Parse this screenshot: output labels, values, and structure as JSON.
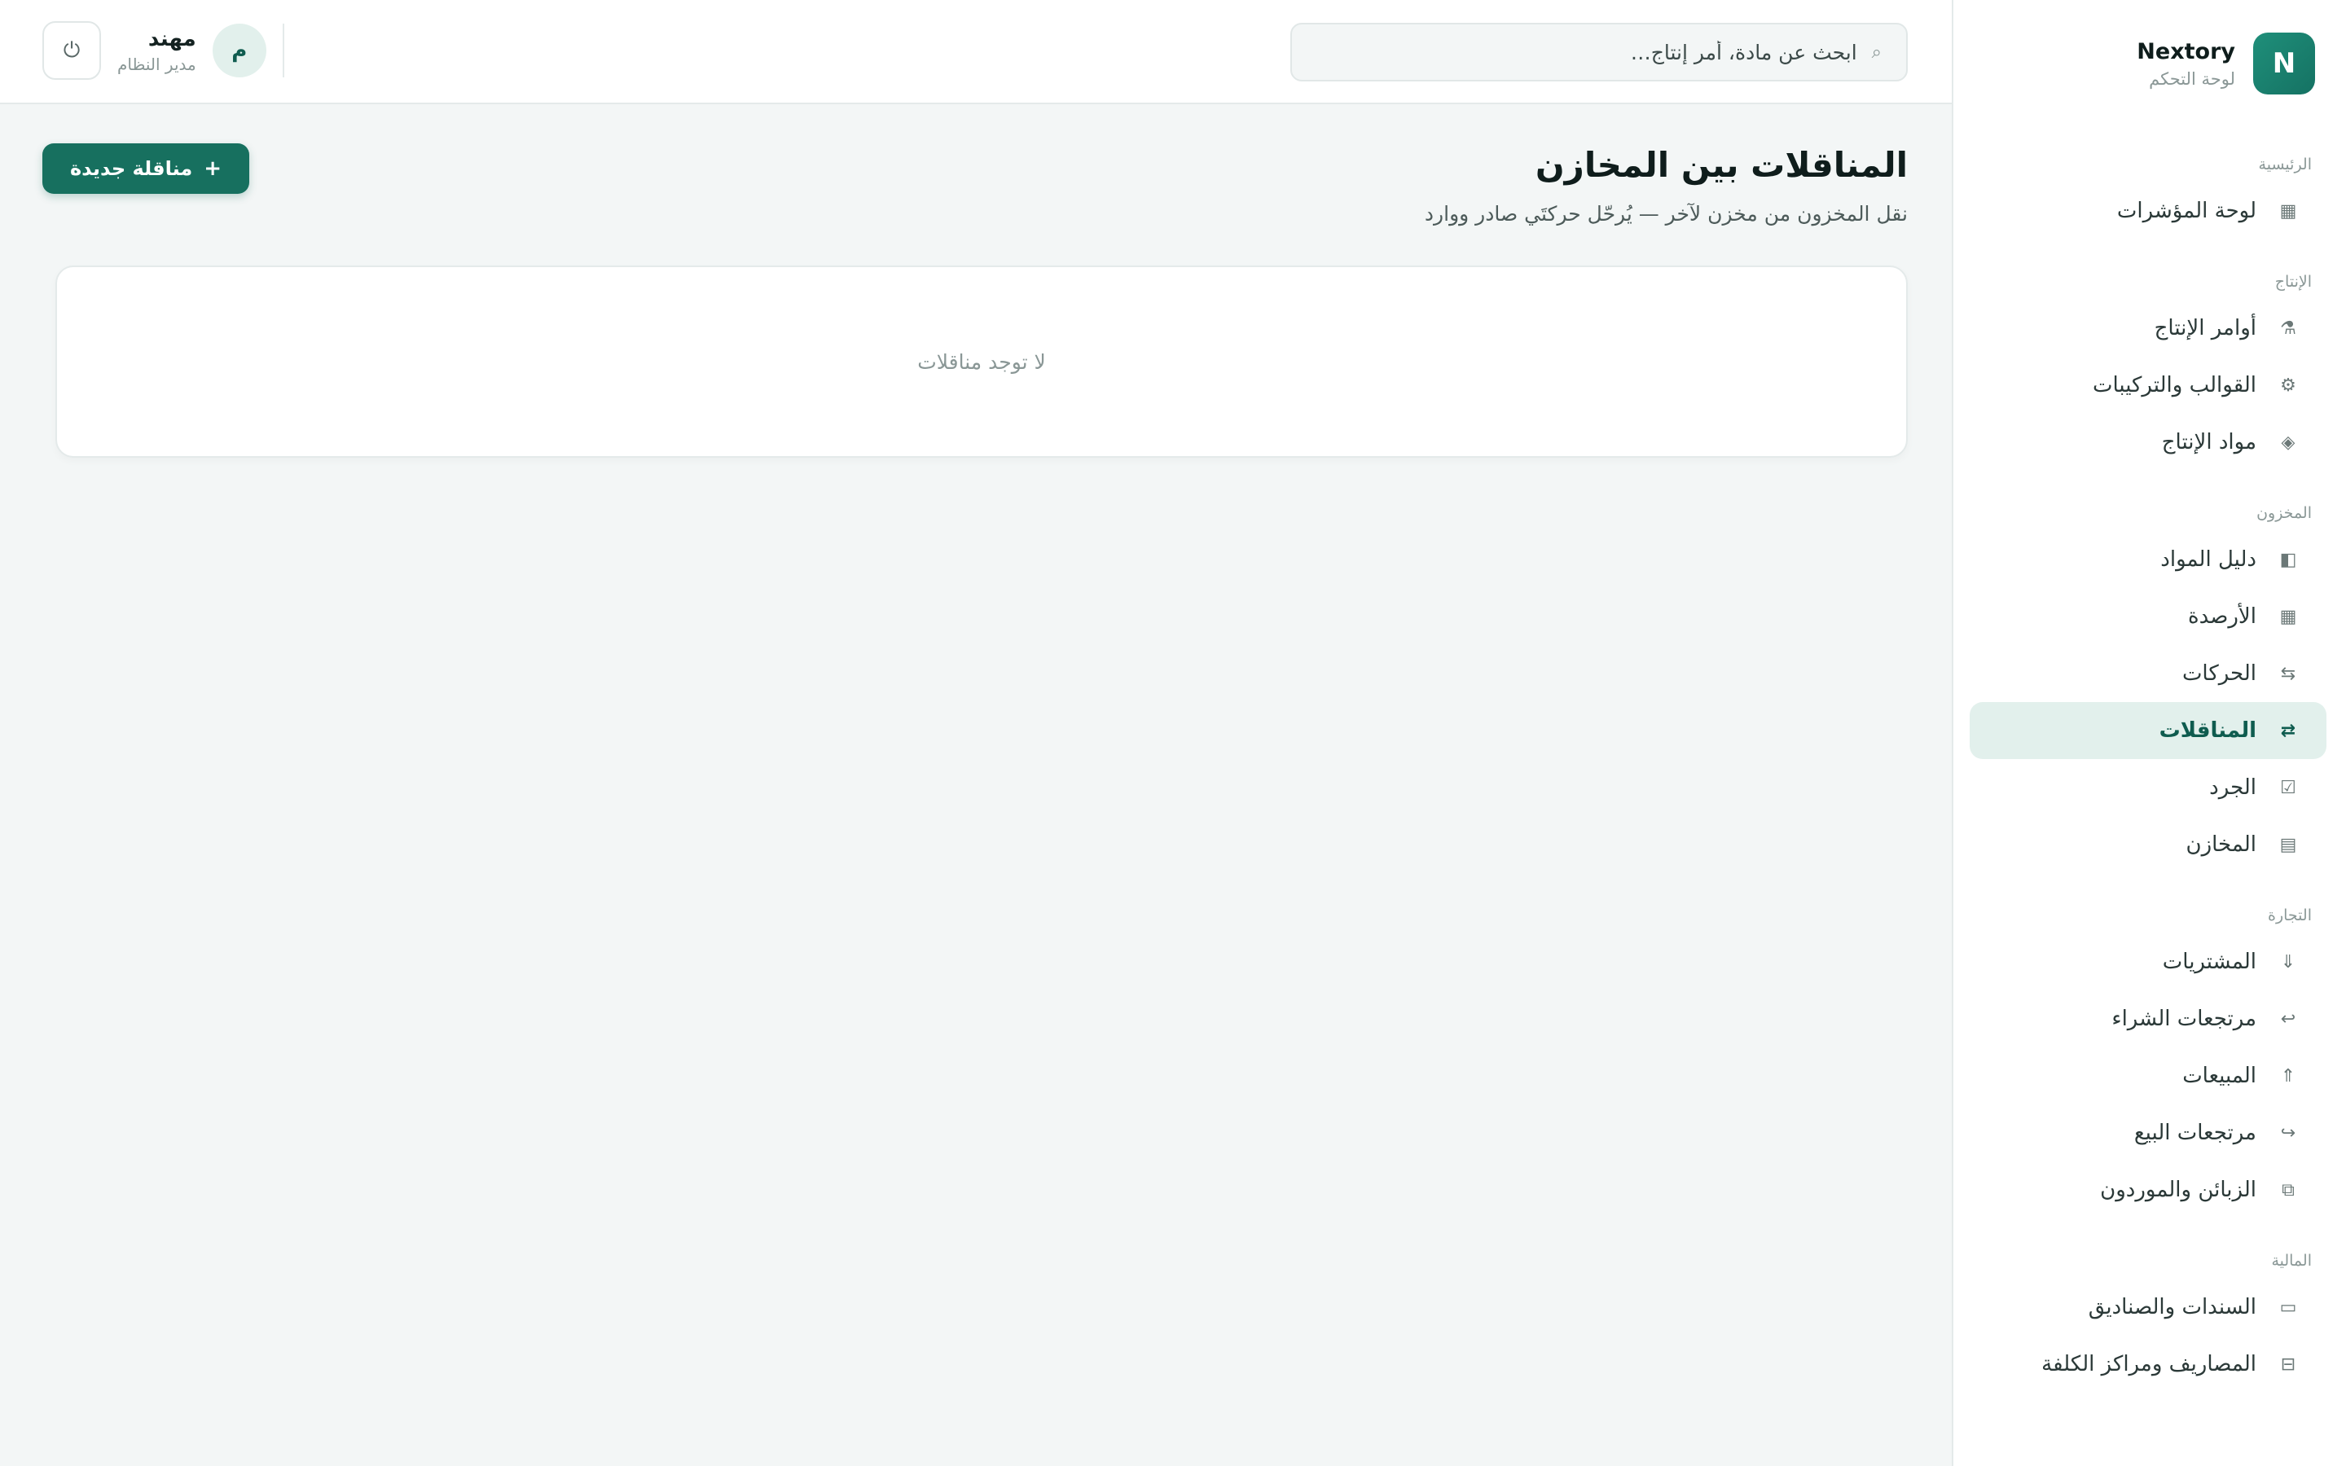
{
  "brand": {
    "logo_letter": "N",
    "name": "Nextory",
    "subtitle": "لوحة التحكم"
  },
  "search": {
    "placeholder": "ابحث عن مادة، أمر إنتاج…",
    "icon": "search-icon"
  },
  "user": {
    "avatar_letter": "م",
    "name": "مهند",
    "role": "مدير النظام",
    "logout_icon": "⏻"
  },
  "sidebar": {
    "sections": [
      {
        "title": "الرئيسية",
        "items": [
          {
            "label": "لوحة المؤشرات",
            "icon": "▦",
            "active": false
          }
        ]
      },
      {
        "title": "الإنتاج",
        "items": [
          {
            "label": "أوامر الإنتاج",
            "icon": "⚗",
            "active": false
          },
          {
            "label": "القوالب والتركيبات",
            "icon": "⚙",
            "active": false
          },
          {
            "label": "مواد الإنتاج",
            "icon": "◈",
            "active": false
          }
        ]
      },
      {
        "title": "المخزون",
        "items": [
          {
            "label": "دليل المواد",
            "icon": "◧",
            "active": false
          },
          {
            "label": "الأرصدة",
            "icon": "▦",
            "active": false
          },
          {
            "label": "الحركات",
            "icon": "⇆",
            "active": false
          },
          {
            "label": "المناقلات",
            "icon": "⇄",
            "active": true
          },
          {
            "label": "الجرد",
            "icon": "☑",
            "active": false
          },
          {
            "label": "المخازن",
            "icon": "▤",
            "active": false
          }
        ]
      },
      {
        "title": "التجارة",
        "items": [
          {
            "label": "المشتريات",
            "icon": "⇓",
            "active": false
          },
          {
            "label": "مرتجعات الشراء",
            "icon": "↩",
            "active": false
          },
          {
            "label": "المبيعات",
            "icon": "⇑",
            "active": false
          },
          {
            "label": "مرتجعات البيع",
            "icon": "↪",
            "active": false
          },
          {
            "label": "الزبائن والموردون",
            "icon": "⧉",
            "active": false
          }
        ]
      },
      {
        "title": "المالية",
        "items": [
          {
            "label": "السندات والصناديق",
            "icon": "▭",
            "active": false
          },
          {
            "label": "المصاريف ومراكز الكلفة",
            "icon": "⊟",
            "active": false
          }
        ]
      }
    ]
  },
  "main": {
    "title": "المناقلات بين المخازن",
    "subtitle": "نقل المخزون من مخزن لآخر — يُرحّل حركتَي صادر ووارد",
    "new_button": {
      "plus": "+",
      "label": "مناقلة جديدة"
    },
    "empty_text": "لا توجد مناقلات"
  }
}
